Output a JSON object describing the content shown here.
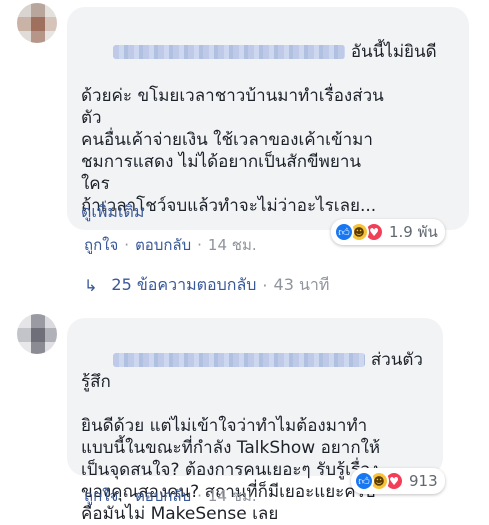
{
  "comments": [
    {
      "text_head": "อันนี้ไม่ยินดี",
      "text_rest": "ด้วยค่ะ ขโมยเวลาชาวบ้านมาทำเรื่องส่วน\nตัว\nคนอื่นเค้าจ่ายเงิน ใช้เวลาของเค้าเข้ามา\nชมการแสดง ไม่ได้อยากเป็นสักขีพยาน\nใคร\nถ้าเวลาโชว์จบแล้วทำจะไม่ว่าอะไรเลย...",
      "see_more": "ดูเพิ่มเติม",
      "reaction_count": "1.9 พัน",
      "actions": {
        "like": "ถูกใจ",
        "reply": "ตอบกลับ",
        "time": "14 ชม."
      },
      "replies": {
        "label": "25 ข้อความตอบกลับ",
        "time": "43 นาที"
      }
    },
    {
      "text_head": "ส่วนตัวรู้สึก",
      "text_rest": "ยินดีด้วย แต่ไม่เข้าใจว่าทำไมต้องมาทำ\nแบบนี้ในขณะที่กำลัง TalkShow อยากให้\nเป็นจุดสนใจ? ต้องการคนเยอะๆ รับรู้เรื่อง\nของคุณสองคน? สถานที่ก็มีเยอะแยะครับ\nคือมันไม่ MakeSense เลย",
      "reaction_count": "913",
      "actions": {
        "like": "ถูกใจ",
        "reply": "ตอบกลับ",
        "time": "14 ชม."
      }
    }
  ],
  "dot": "·",
  "icons": {
    "like": "thumbs-up-icon",
    "haha": "laughing-face-icon",
    "love": "heart-icon",
    "reply_arrow": "reply-arrow-icon"
  },
  "colors": {
    "bubble": "#f2f3f5",
    "link": "#385898",
    "meta": "#90949c",
    "like": "#1877f2",
    "haha": "#f7c33b",
    "love": "#f33e58"
  }
}
